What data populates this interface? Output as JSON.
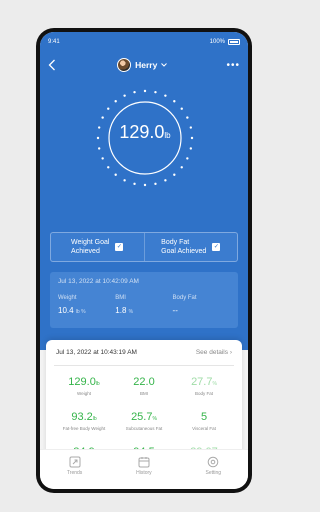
{
  "status": {
    "time": "9:41",
    "battery": "100%"
  },
  "header": {
    "user_name": "Herry",
    "more": "•••"
  },
  "dial": {
    "weight": "129.0",
    "unit": "lb"
  },
  "goals": [
    {
      "label_line1": "Weight Goal",
      "label_line2": "Achieved"
    },
    {
      "label_line1": "Body Fat",
      "label_line2": "Goal Achieved"
    }
  ],
  "previous": {
    "date": "Jul 13, 2022 at 10:42:09 AM",
    "labels": [
      "Weight",
      "BMI",
      "Body Fat"
    ],
    "values": [
      {
        "v": "10.4",
        "u": "lb  %"
      },
      {
        "v": "1.8",
        "u": "%"
      },
      {
        "v": "--",
        "u": ""
      }
    ]
  },
  "card": {
    "date": "Jul 13, 2022 at 10:43:19 AM",
    "see_details": "See details",
    "metrics": [
      {
        "value": "129.0",
        "unit": "lb",
        "label": "Weight"
      },
      {
        "value": "22.0",
        "unit": "",
        "label": "BMI"
      },
      {
        "value": "27.7",
        "unit": "%",
        "label": "Body Fat"
      },
      {
        "value": "93.2",
        "unit": "lb",
        "label": "Fat-free Body Weight"
      },
      {
        "value": "25.7",
        "unit": "%",
        "label": "Subcutaneous Fat"
      },
      {
        "value": "5",
        "unit": "",
        "label": "Visceral Fat"
      },
      {
        "value": "84.9",
        "unit": "",
        "label": ""
      },
      {
        "value": "94.5",
        "unit": "",
        "label": ""
      },
      {
        "value": "39.07",
        "unit": "",
        "label": ""
      }
    ]
  },
  "tabs": [
    {
      "label": "Trends",
      "icon": "trend-arrow-icon"
    },
    {
      "label": "History",
      "icon": "calendar-icon"
    },
    {
      "label": "Setting",
      "icon": "gear-icon"
    }
  ],
  "colors": {
    "primary": "#2f72c8",
    "accent_green": "#35b44a"
  }
}
